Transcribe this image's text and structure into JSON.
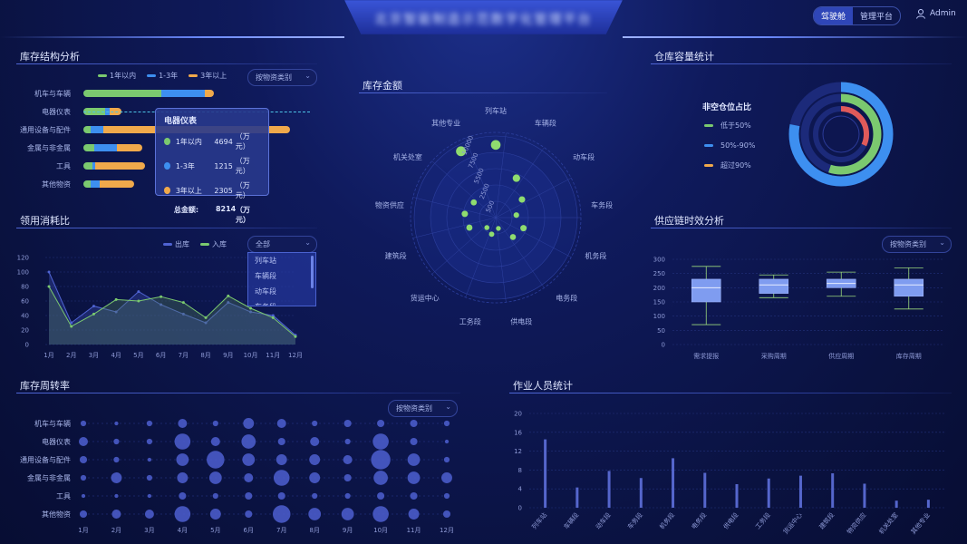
{
  "header": {
    "title": "北京智能制造示范数字化管理平台",
    "buttons": [
      "驾驶舱",
      "管理平台"
    ],
    "active_button": 0,
    "user": "Admin"
  },
  "inventory_structure": {
    "title": "库存结构分析",
    "legend": [
      "1年以内",
      "1-3年",
      "3年以上"
    ],
    "colors": [
      "#7bc96f",
      "#3d8ff0",
      "#f0a94b"
    ],
    "dropdown": "按物资类别",
    "categories": [
      "机车与车辆",
      "电器仪表",
      "通用设备与配件",
      "金属与非金属",
      "工具",
      "其他物资"
    ],
    "values": [
      [
        86,
        48,
        10
      ],
      [
        24,
        5,
        13
      ],
      [
        8,
        14,
        206
      ],
      [
        12,
        25,
        28
      ],
      [
        10,
        3,
        55
      ],
      [
        8,
        10,
        38
      ]
    ],
    "tooltip": {
      "title": "电器仪表",
      "rows": [
        {
          "name": "1年以内",
          "value": "4694",
          "unit": "（万元）"
        },
        {
          "name": "1-3年",
          "value": "1215",
          "unit": "（万元）"
        },
        {
          "name": "3年以上",
          "value": "2305",
          "unit": "（万元）"
        }
      ],
      "total_label": "总金额:",
      "total_value": "8214",
      "total_unit": "（万元）"
    }
  },
  "consumption": {
    "title": "领用消耗比",
    "legend": [
      "出库",
      "入库"
    ],
    "colors": [
      "#4f63d2",
      "#7bc96f"
    ],
    "dropdown": "全部",
    "dropdown_options": [
      "列车站",
      "车辆段",
      "动车段",
      "车务段"
    ],
    "months": [
      "1月",
      "2月",
      "3月",
      "4月",
      "5月",
      "6月",
      "7月",
      "8月",
      "9月",
      "10月",
      "11月",
      "12月"
    ],
    "ylim": [
      0,
      120
    ],
    "yticks": [
      "0",
      "20",
      "40",
      "60",
      "80",
      "100",
      "120"
    ],
    "out_values": [
      100,
      30,
      53,
      45,
      73,
      55,
      42,
      30,
      58,
      45,
      40,
      13
    ],
    "in_values": [
      80,
      25,
      42,
      62,
      60,
      66,
      58,
      37,
      67,
      50,
      37,
      11
    ]
  },
  "inventory_amount": {
    "title": "库存金额",
    "angular_labels": [
      "列车站",
      "车辆段",
      "动车段",
      "车务段",
      "机务段",
      "电务段",
      "供电段",
      "工务段",
      "货运中心",
      "建筑段",
      "物资供应",
      "机关处室",
      "其他专业"
    ],
    "radial_ticks": [
      "500",
      "2500",
      "5500",
      "7500",
      "10000"
    ],
    "values": [
      9800,
      6000,
      4300,
      2800,
      4000,
      3500,
      1500,
      2300,
      1800,
      3800,
      4200,
      3600,
      10100
    ]
  },
  "warehouse": {
    "title": "仓库容量统计",
    "subtitle": "非空仓位占比",
    "legend": [
      "低于50%",
      "50%-90%",
      "超过90%"
    ],
    "colors": [
      "#7bc96f",
      "#3d8ff0",
      "#f0a94b"
    ],
    "rings": [
      {
        "color": "#3d8ff0",
        "value": 0.78
      },
      {
        "color": "#7bc96f",
        "value": 0.55
      },
      {
        "color": "#e05a5a",
        "value": 0.32
      }
    ]
  },
  "supply_chain": {
    "title": "供应链时效分析",
    "dropdown": "按物资类别",
    "yticks": [
      "0",
      "50",
      "100",
      "150",
      "200",
      "250",
      "300"
    ],
    "categories": [
      "需求提报",
      "采购周期",
      "供应周期",
      "库存周期"
    ],
    "boxes": [
      {
        "min": 70,
        "q1": 150,
        "median": 200,
        "q3": 230,
        "max": 275
      },
      {
        "min": 165,
        "q1": 180,
        "median": 210,
        "q3": 230,
        "max": 245
      },
      {
        "min": 170,
        "q1": 200,
        "median": 215,
        "q3": 230,
        "max": 255
      },
      {
        "min": 125,
        "q1": 170,
        "median": 210,
        "q3": 230,
        "max": 270
      }
    ]
  },
  "turnover": {
    "title": "库存周转率",
    "dropdown": "按物资类别",
    "categories": [
      "机车与车辆",
      "电器仪表",
      "通用设备与配件",
      "金属与非金属",
      "工具",
      "其他物资"
    ],
    "months": [
      "1月",
      "2月",
      "3月",
      "4月",
      "5月",
      "6月",
      "7月",
      "8月",
      "9月",
      "10月",
      "11月",
      "12月"
    ],
    "sizes": [
      [
        2,
        1,
        2,
        4,
        2,
        5,
        4,
        2,
        3,
        3,
        3,
        2
      ],
      [
        4,
        2,
        2,
        8,
        4,
        7,
        3,
        4,
        2,
        8,
        3,
        1
      ],
      [
        3,
        2,
        1,
        6,
        9,
        6,
        5,
        5,
        4,
        10,
        6,
        2
      ],
      [
        2,
        5,
        2,
        5,
        6,
        4,
        8,
        5,
        3,
        7,
        6,
        5
      ],
      [
        1,
        1,
        1,
        3,
        2,
        3,
        3,
        2,
        2,
        3,
        3,
        2
      ],
      [
        3,
        4,
        4,
        8,
        5,
        3,
        9,
        6,
        6,
        8,
        5,
        3
      ]
    ]
  },
  "workers": {
    "title": "作业人员统计",
    "ylim": [
      0,
      20
    ],
    "yticks": [
      "0",
      "4",
      "8",
      "12",
      "16",
      "20"
    ],
    "categories": [
      "列车站",
      "车辆段",
      "动车段",
      "车务段",
      "机务段",
      "电务段",
      "供电段",
      "工务段",
      "货运中心",
      "建筑段",
      "物资供应",
      "机关处室",
      "其他专业"
    ],
    "values": [
      14.5,
      4.3,
      7.8,
      6.3,
      10.5,
      7.4,
      5,
      6.2,
      6.8,
      7.3,
      5.1,
      1.5,
      1.7
    ]
  }
}
